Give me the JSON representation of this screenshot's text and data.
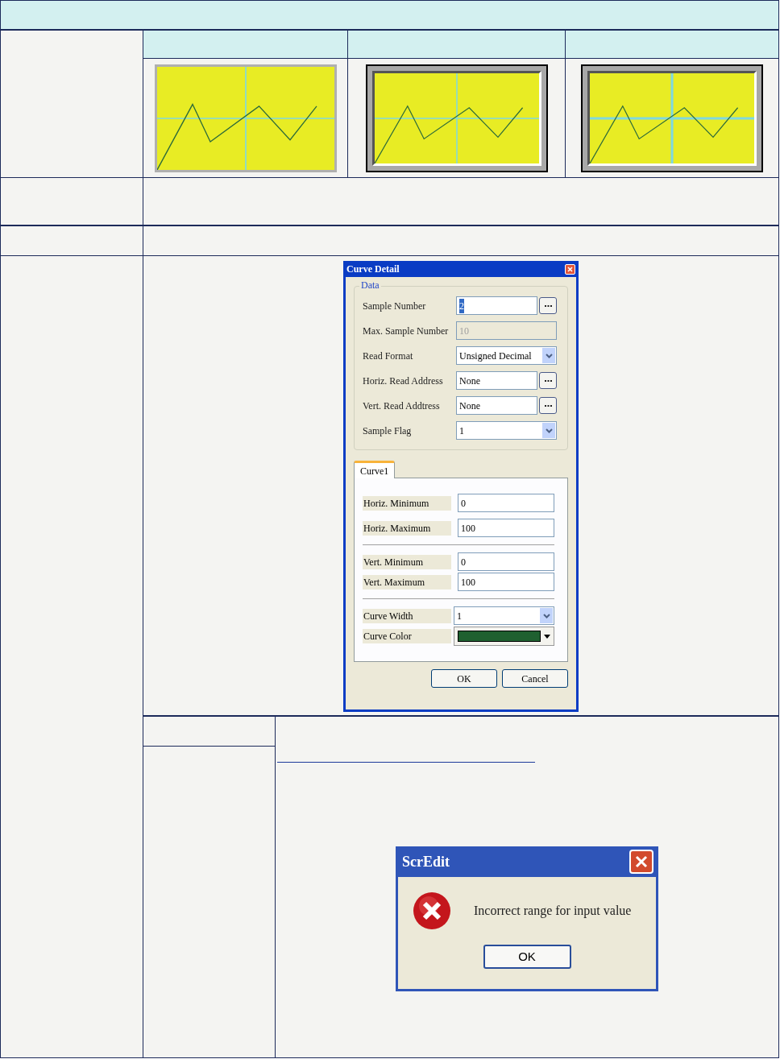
{
  "previews": [
    {
      "kind": "flat"
    },
    {
      "kind": "sunken"
    },
    {
      "kind": "raised"
    }
  ],
  "curve_detail": {
    "title": "Curve Detail",
    "group": "Data",
    "fields": [
      {
        "kind": "browse",
        "label": "Sample Number",
        "value": "2",
        "selected": true
      },
      {
        "kind": "disabled",
        "label": "Max. Sample Number",
        "value": "10"
      },
      {
        "kind": "select",
        "label": "Read Format",
        "value": "Unsigned Decimal"
      },
      {
        "kind": "browse",
        "label": "Horiz. Read Address",
        "value": "None",
        "selected": false
      },
      {
        "kind": "browse",
        "label": "Vert. Read Addtress",
        "value": "None",
        "selected": false
      },
      {
        "kind": "select",
        "label": "Sample Flag",
        "value": "1"
      }
    ],
    "tabs": [
      {
        "label": "Curve1",
        "selected": true
      }
    ],
    "tab_groups": [
      [
        {
          "kind": "text",
          "label": "Horiz. Minimum",
          "value": "0"
        },
        {
          "kind": "text",
          "label": "Horiz. Maximum",
          "value": "100"
        }
      ],
      [
        {
          "kind": "text",
          "label": "Vert. Minimum",
          "value": "0"
        },
        {
          "kind": "text",
          "label": "Vert. Maximum",
          "value": "100"
        }
      ],
      [
        {
          "kind": "select",
          "label": "Curve Width",
          "value": "1"
        },
        {
          "kind": "color",
          "label": "Curve Color",
          "color": "#1f6030"
        }
      ]
    ],
    "buttons": [
      "OK",
      "Cancel"
    ]
  },
  "error_dialog": {
    "title": "ScrEdit",
    "message": "Incorrect range for input value",
    "button": "OK"
  }
}
